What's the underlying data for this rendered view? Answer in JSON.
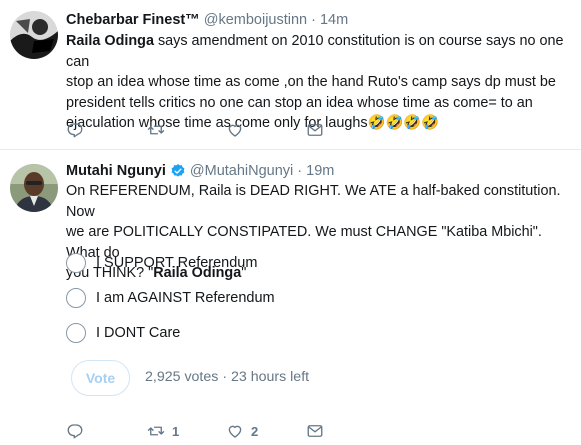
{
  "tweets": [
    {
      "author": {
        "name": "Chebarbar Finest™",
        "handle": "@kemboijustinn",
        "separator": "·",
        "time": "14m"
      },
      "text_lines": [
        {
          "bold": "Raila Odinga",
          "rest": " says amendment on 2010 constitution is on course says no one can"
        },
        {
          "bold": "",
          "rest": "stop an idea whose time as come ,on the hand Ruto's camp says dp must be"
        },
        {
          "bold": "",
          "rest": "president tells critics no one can stop an idea whose time as come=  to an"
        },
        {
          "bold": "",
          "rest": "ejaculation whose time as come only for laughs🤣🤣🤣🤣"
        }
      ],
      "actions": {
        "reply_count": "",
        "retweet_count": "",
        "like_count": ""
      }
    },
    {
      "author": {
        "name": "Mutahi Ngunyi",
        "handle": "@MutahiNgunyi",
        "separator": "·",
        "time": "19m",
        "verified": true
      },
      "text_lines": [
        "On REFERENDUM, Raila is DEAD RIGHT. We ATE a half-baked constitution. Now",
        "we are POLITICALLY CONSTIPATED.  We must CHANGE \"Katiba Mbichi\". What do",
        "you THINK?  \"",
        "Raila Odinga",
        "\""
      ],
      "poll": {
        "options": [
          "I SUPPORT Referendum",
          "I am AGAINST Referendum",
          "I DONT Care"
        ],
        "vote_label": "Vote",
        "votes": "2,925 votes",
        "separator": "·",
        "remaining": "23 hours left"
      },
      "actions": {
        "reply_count": "",
        "retweet_count": "1",
        "like_count": "2"
      }
    }
  ],
  "colors": {
    "accent": "#1da1f2",
    "muted": "#657786",
    "divider": "#e6ecf0"
  }
}
